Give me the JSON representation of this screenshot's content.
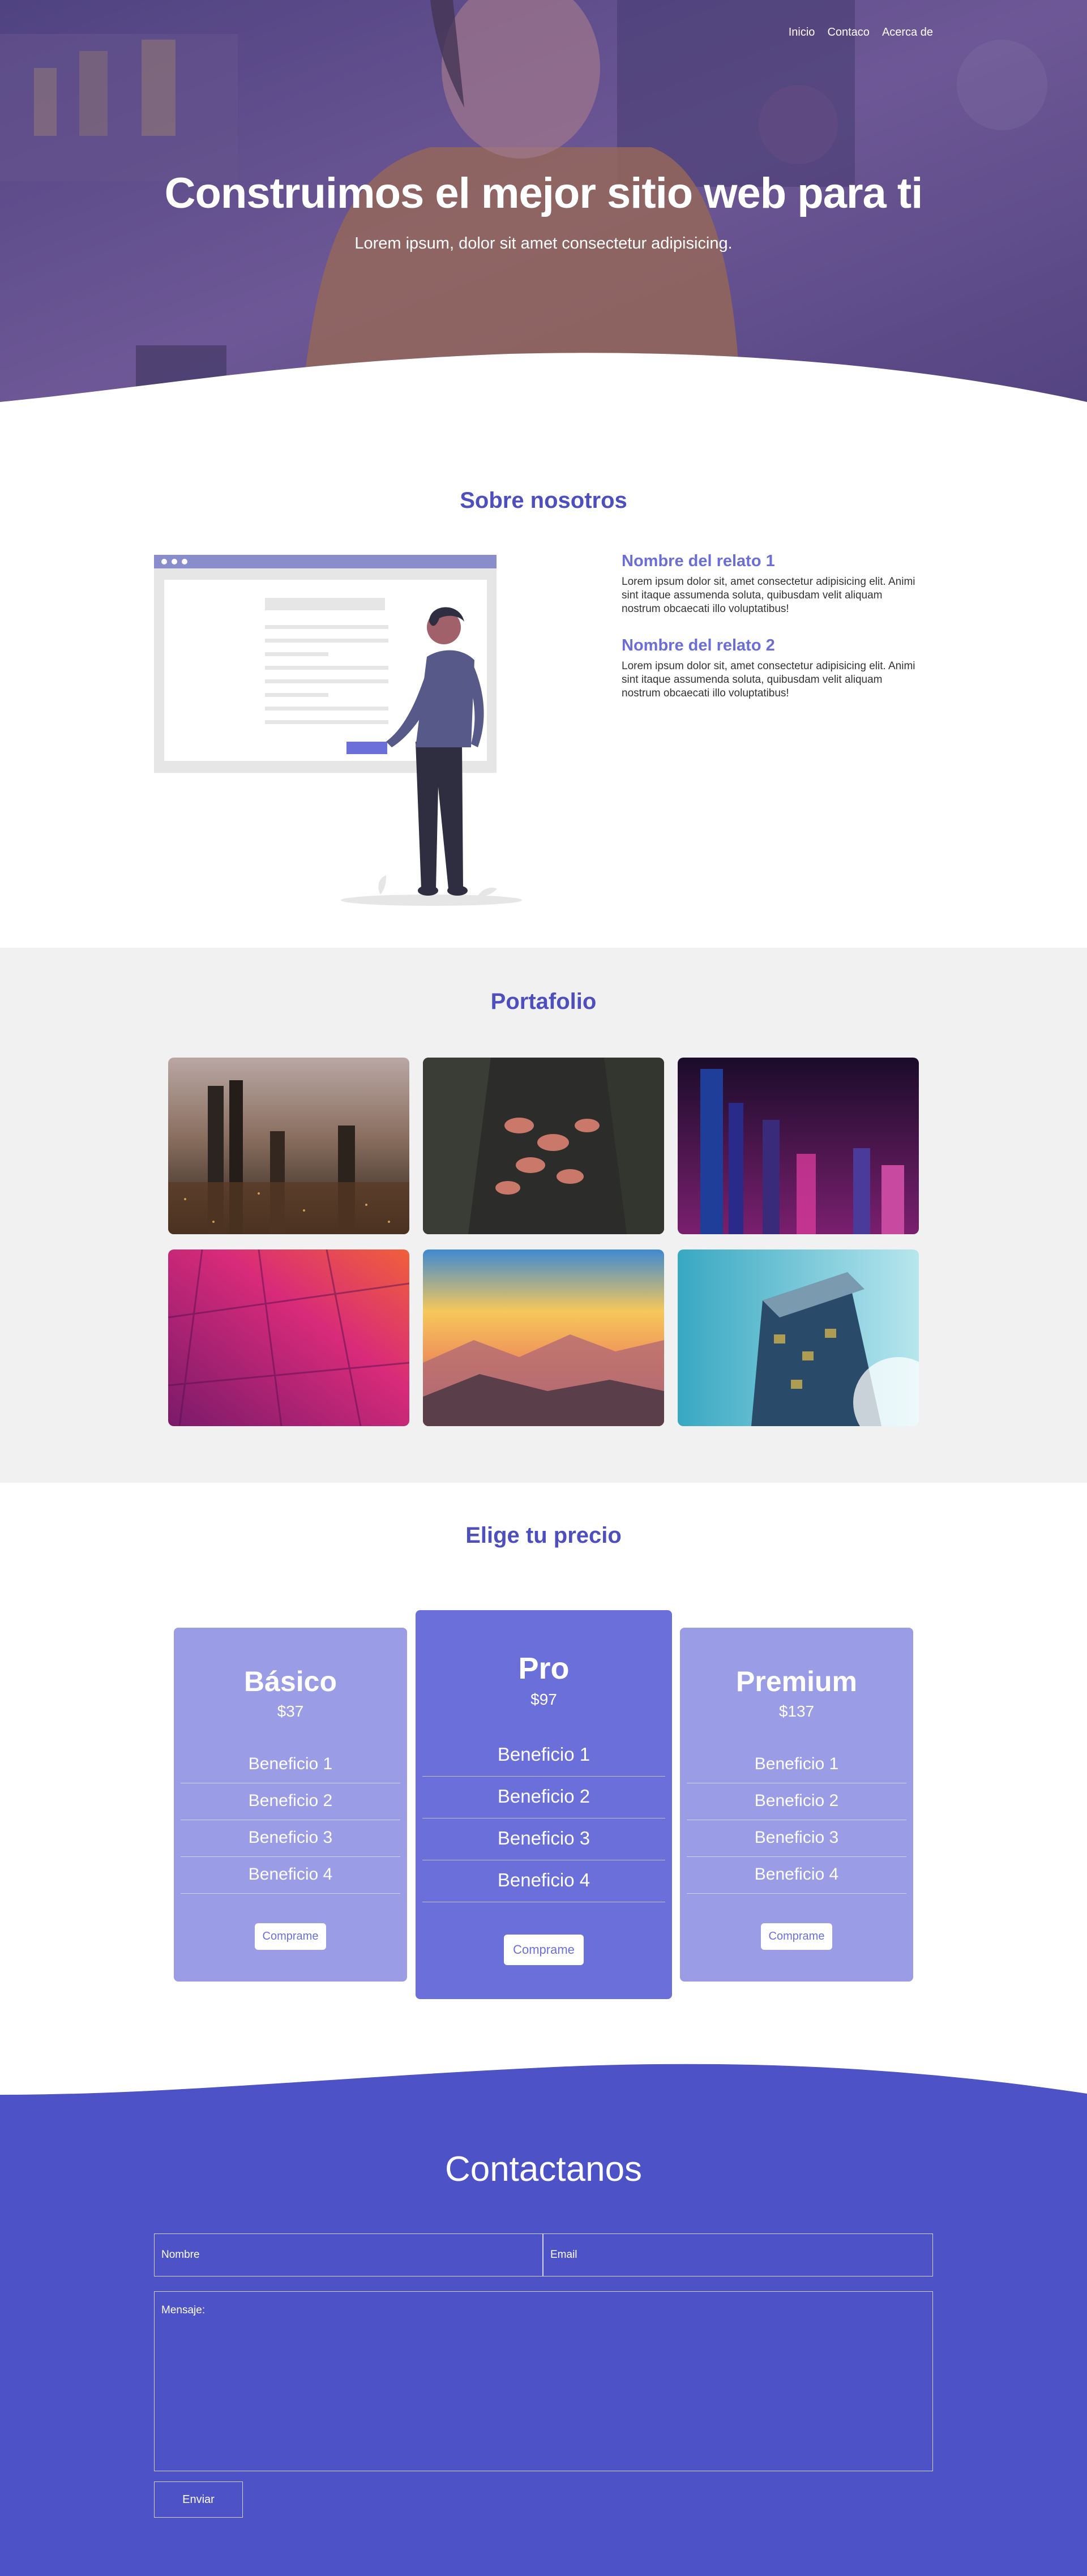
{
  "nav": {
    "items": [
      "Inicio",
      "Contaco",
      "Acerca de"
    ]
  },
  "hero": {
    "title": "Construimos el mejor sitio web para ti",
    "subtitle": "Lorem ipsum, dolor sit amet consectetur adipisicing."
  },
  "about": {
    "title": "Sobre nosotros",
    "stories": [
      {
        "title": "Nombre del relato 1",
        "text": "Lorem ipsum dolor sit, amet consectetur adipisicing elit. Animi sint itaque assumenda soluta, quibusdam velit aliquam nostrum obcaecati illo voluptatibus!"
      },
      {
        "title": "Nombre del relato 2",
        "text": "Lorem ipsum dolor sit, amet consectetur adipisicing elit. Animi sint itaque assumenda soluta, quibusdam velit aliquam nostrum obcaecati illo voluptatibus!"
      }
    ]
  },
  "portfolio": {
    "title": "Portafolio",
    "images": [
      "city-night-aerial",
      "flamingos",
      "skyscrapers-night",
      "magenta-facade",
      "mountain-sunset",
      "glass-building"
    ]
  },
  "pricing": {
    "title": "Elige tu precio",
    "plans": [
      {
        "name": "Básico",
        "price": "$37",
        "benefits": [
          "Beneficio 1",
          "Beneficio 2",
          "Beneficio 3",
          "Beneficio 4"
        ],
        "button": "Comprame"
      },
      {
        "name": "Pro",
        "price": "$97",
        "benefits": [
          "Beneficio 1",
          "Beneficio 2",
          "Beneficio 3",
          "Beneficio 4"
        ],
        "button": "Comprame"
      },
      {
        "name": "Premium",
        "price": "$137",
        "benefits": [
          "Beneficio 1",
          "Beneficio 2",
          "Beneficio 3",
          "Beneficio 4"
        ],
        "button": "Comprame"
      }
    ]
  },
  "contact": {
    "title": "Contactanos",
    "name_placeholder": "Nombre",
    "email_placeholder": "Email",
    "message_placeholder": "Mensaje:",
    "submit": "Enviar"
  },
  "colors": {
    "accent": "#4e4fbf",
    "card_light": "#9a9de6",
    "card_pro": "#6b6fd9",
    "contact_bg": "#4d52c6"
  }
}
